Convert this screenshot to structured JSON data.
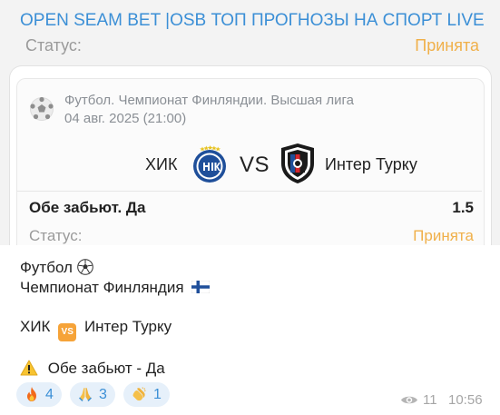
{
  "channel": {
    "title": "OPEN SEAM BET |OSB ТОП ПРОГНОЗЫ НА СПОРТ LIVE"
  },
  "header_status": {
    "label": "Статус:",
    "value": "Принята"
  },
  "card": {
    "league": "Футбол. Чемпионат Финляндии. Высшая лига",
    "date": "04 авг. 2025 (21:00)",
    "home_team": "ХИК",
    "vs": "VS",
    "away_team": "Интер Турку",
    "bet_name": "Обе забьют. Да",
    "odds": "1.5",
    "status_label": "Статус:",
    "status_value": "Принята"
  },
  "message": {
    "sport": "Футбол",
    "championship": "Чемпионат Финляндия",
    "home_team": "ХИК",
    "vs_badge": "VS",
    "away_team": "Интер Турку",
    "bet": "Обе забьют - Да"
  },
  "reactions": [
    {
      "emoji": "fire-icon",
      "count": "4"
    },
    {
      "emoji": "pray-icon",
      "count": "3"
    },
    {
      "emoji": "clap-icon",
      "count": "1"
    }
  ],
  "meta": {
    "views": "11",
    "time": "10:56"
  },
  "colors": {
    "accent": "#3b8fd6",
    "status": "#f0b04a",
    "vs_badge": "#f6a338"
  }
}
